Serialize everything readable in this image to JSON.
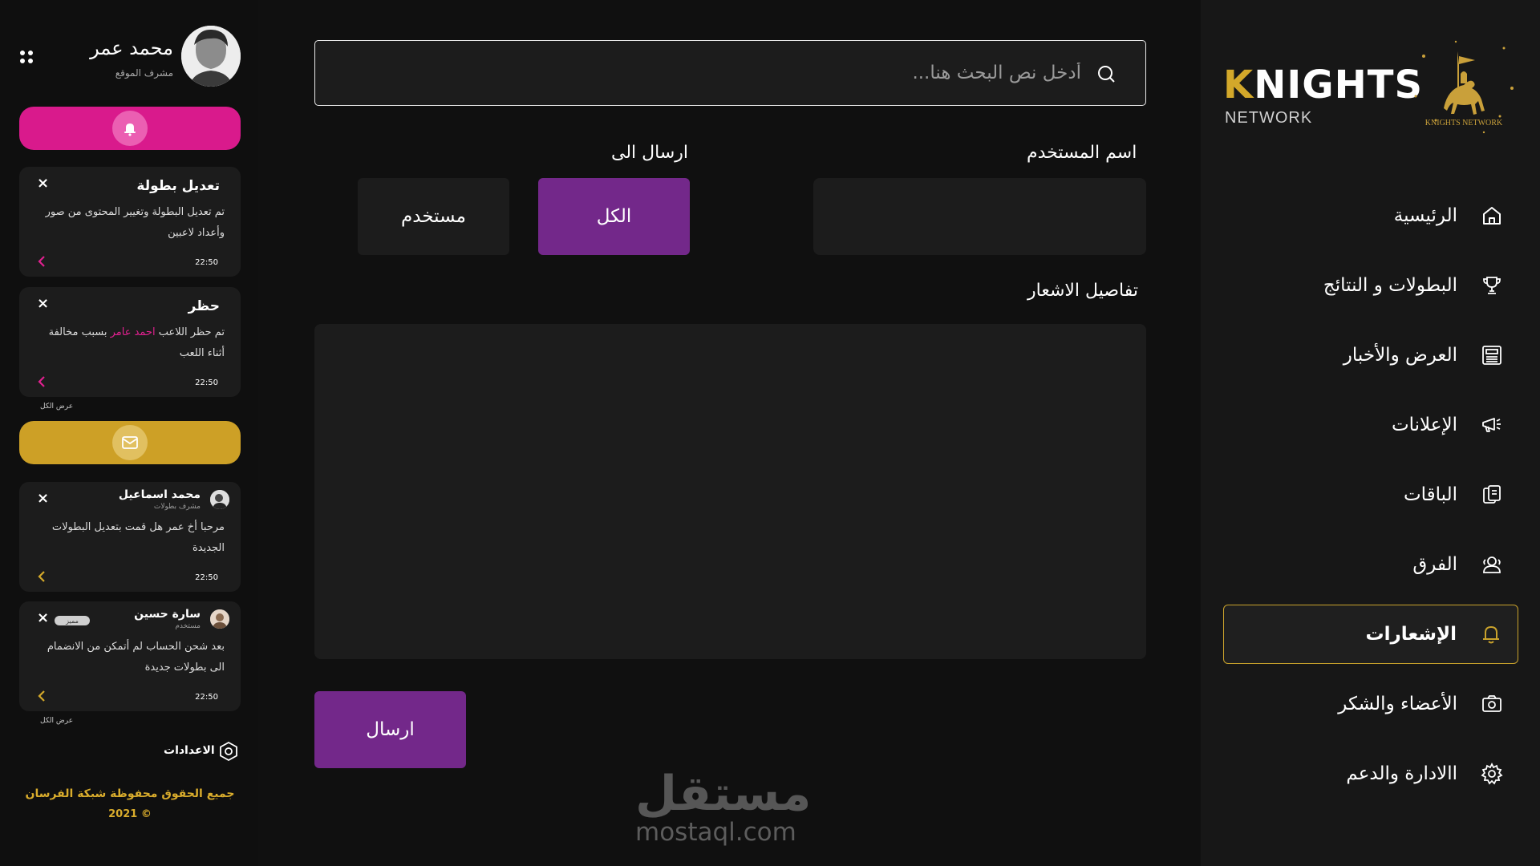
{
  "brand": {
    "word_k": "K",
    "word_rest": "NIGHTS",
    "sub": "NETWORK",
    "emblem_text": "KNIGHTS NETWORK",
    "accent": "#c9a22c"
  },
  "nav": {
    "items": [
      {
        "label": "الرئيسية",
        "icon": "home-icon"
      },
      {
        "label": "البطولات و النتائج",
        "icon": "trophy-icon"
      },
      {
        "label": "العرض والأخبار",
        "icon": "newspaper-icon"
      },
      {
        "label": "الإعلانات",
        "icon": "megaphone-icon"
      },
      {
        "label": "الباقات",
        "icon": "package-icon"
      },
      {
        "label": "الفرق",
        "icon": "team-icon"
      },
      {
        "label": "الإشعارات",
        "icon": "bell-icon",
        "active": true
      },
      {
        "label": "الأعضاء والشكر",
        "icon": "members-icon"
      },
      {
        "label": "االادارة والدعم",
        "icon": "settings-icon"
      }
    ]
  },
  "search": {
    "placeholder": "أدخل نص البحث هنا..."
  },
  "form": {
    "username_label": "اسم المستخدم",
    "username_value": "",
    "send_to_label": "ارسال الى",
    "option_all": "الكل",
    "option_user": "مستخدم",
    "details_label": "تفاصيل الاشعار",
    "details_value": "",
    "submit": "ارسال",
    "accent": "#73288a"
  },
  "watermark": {
    "ar": "مستقل",
    "en": "mostaql.com"
  },
  "profile": {
    "name": "محمد عمر",
    "role": "مشرف الموقع"
  },
  "notifications": {
    "bar_color": "#d91a8c",
    "cards": [
      {
        "title": "تعديل بطولة",
        "body": "تم تعديل البطولة وتغيير المحتوى من صور وأعداد لاعبين",
        "time": "22:50"
      },
      {
        "title": "حظر",
        "body_before": "تم حظر اللاعب",
        "highlight": "احمد عامر",
        "body_after": "بسبب مخالفة أثناء اللعب",
        "time": "22:50"
      }
    ],
    "view_all": "عرض الكل"
  },
  "messages": {
    "bar_color": "#cda026",
    "cards": [
      {
        "name": "محمد اسماعيل",
        "role": "مشرف بطولات",
        "body": "مرحبا أخ عمر هل قمت بتعديل البطولات الجديدة",
        "time": "22:50"
      },
      {
        "name": "سارة حسين",
        "role": "مستخدم",
        "badge": "مميز",
        "body": "بعد شحن الحساب لم أتمكن من الانضمام الى بطولات جديدة",
        "time": "22:50"
      }
    ],
    "view_all": "عرض الكل"
  },
  "settings_label": "الاعدادات",
  "footer": {
    "line1": "جميع الحقوق محفوظة شبكة الفرسان",
    "line2": "© 2021"
  }
}
